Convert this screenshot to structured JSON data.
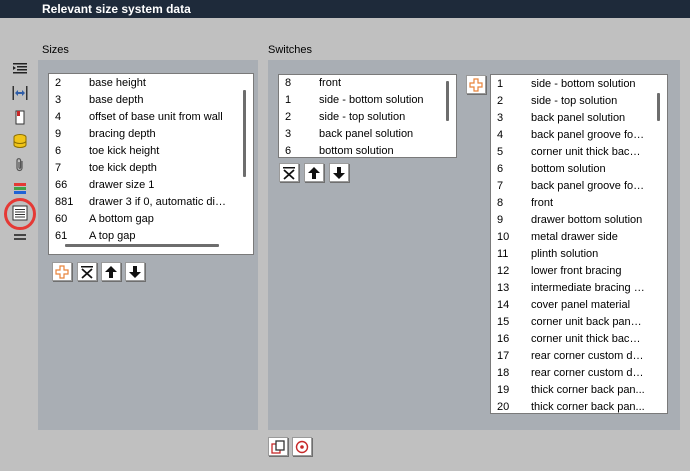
{
  "window": {
    "title": "Relevant size system data"
  },
  "sections": {
    "sizes_label": "Sizes",
    "switches_label": "Switches"
  },
  "toolbar_icons": [
    "indent-list-icon",
    "width-arrows-icon",
    "red-panel-icon",
    "database-icon",
    "paperclip-icon",
    "color-bars-icon",
    "list-lines-icon",
    "double-lines-icon"
  ],
  "sizes": {
    "items": [
      {
        "num": "2",
        "label": "base height"
      },
      {
        "num": "3",
        "label": "base depth"
      },
      {
        "num": "4",
        "label": "offset of base unit from wall"
      },
      {
        "num": "9",
        "label": "bracing depth"
      },
      {
        "num": "6",
        "label": "toe kick height"
      },
      {
        "num": "7",
        "label": "toe kick depth"
      },
      {
        "num": "66",
        "label": "drawer size 1"
      },
      {
        "num": "881",
        "label": "drawer 3 if 0, automatic divis..."
      },
      {
        "num": "60",
        "label": "A bottom gap"
      },
      {
        "num": "61",
        "label": "A top gap"
      }
    ]
  },
  "switches_selected": {
    "items": [
      {
        "num": "8",
        "label": "front"
      },
      {
        "num": "1",
        "label": "side - bottom solution"
      },
      {
        "num": "2",
        "label": "side - top solution"
      },
      {
        "num": "3",
        "label": "back panel solution"
      },
      {
        "num": "6",
        "label": "bottom solution"
      }
    ]
  },
  "switches_available": {
    "items": [
      {
        "num": "1",
        "label": "side - bottom solution"
      },
      {
        "num": "2",
        "label": "side - top solution"
      },
      {
        "num": "3",
        "label": "back panel solution"
      },
      {
        "num": "4",
        "label": "back panel groove for ..."
      },
      {
        "num": "5",
        "label": "corner unit thick back ..."
      },
      {
        "num": "6",
        "label": "bottom solution"
      },
      {
        "num": "7",
        "label": "back panel groove for ..."
      },
      {
        "num": "8",
        "label": "front"
      },
      {
        "num": "9",
        "label": "drawer bottom solution"
      },
      {
        "num": "10",
        "label": "metal drawer side"
      },
      {
        "num": "11",
        "label": "plinth solution"
      },
      {
        "num": "12",
        "label": "lower front bracing"
      },
      {
        "num": "13",
        "label": "intermediate bracing left"
      },
      {
        "num": "14",
        "label": "cover panel material"
      },
      {
        "num": "15",
        "label": "corner unit back panel..."
      },
      {
        "num": "16",
        "label": "corner unit thick back ..."
      },
      {
        "num": "17",
        "label": "rear corner custom de..."
      },
      {
        "num": "18",
        "label": "rear corner custom de..."
      },
      {
        "num": "19",
        "label": "thick corner back pan..."
      },
      {
        "num": "20",
        "label": "thick corner back pan..."
      }
    ]
  },
  "colors": {
    "title_bar": "#1e2a3a",
    "panel": "#a9aeb4",
    "highlight": "#e53935",
    "add_icon": "#e8833a"
  }
}
